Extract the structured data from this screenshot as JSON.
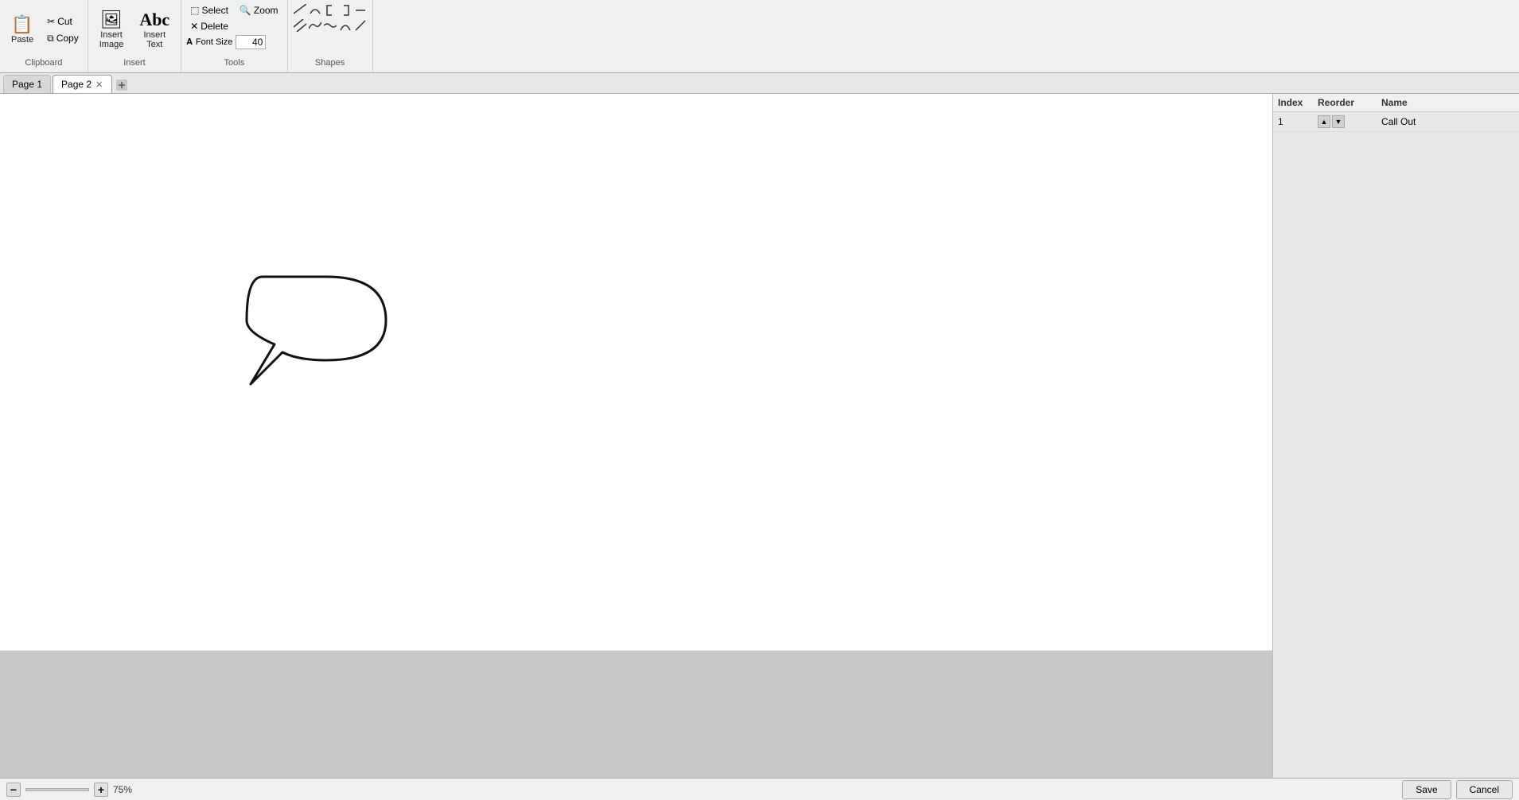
{
  "tabs": [
    {
      "label": "Page 1",
      "active": false,
      "closeable": false
    },
    {
      "label": "Page 2",
      "active": true,
      "closeable": true
    }
  ],
  "toolbar": {
    "clipboard": {
      "label": "Clipboard",
      "paste_label": "Paste",
      "cut_label": "Cut",
      "copy_label": "Copy"
    },
    "insert": {
      "label": "Insert",
      "insert_image_label": "Insert\nImage",
      "insert_text_label": "Insert\nText"
    },
    "tools": {
      "label": "Tools",
      "zoom_label": "Zoom",
      "delete_label": "Delete",
      "select_label": "Select",
      "font_size_label": "Font Size",
      "font_size_value": "40"
    },
    "shapes": {
      "label": "Shapes"
    }
  },
  "right_panel": {
    "index_label": "Index",
    "reorder_label": "Reorder",
    "name_label": "Name",
    "rows": [
      {
        "index": "1",
        "name": "Call Out"
      }
    ]
  },
  "status_bar": {
    "zoom_percent": "75%",
    "save_label": "Save",
    "cancel_label": "Cancel"
  },
  "shapes": [
    "╱",
    "⌒",
    "⬜",
    "⬜",
    "—",
    "╱╱",
    "∫",
    "~",
    "⌒",
    "/"
  ]
}
